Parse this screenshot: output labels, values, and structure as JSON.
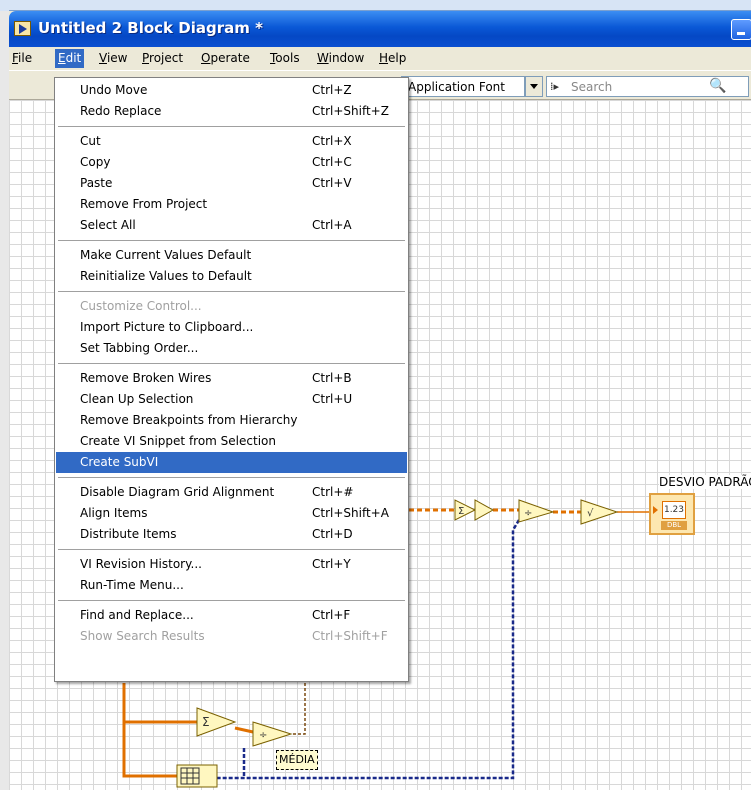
{
  "window": {
    "title": "Untitled 2 Block Diagram *"
  },
  "menubar": {
    "items": [
      {
        "label": "File",
        "u": "F",
        "rest": "ile"
      },
      {
        "label": "Edit",
        "u": "E",
        "rest": "dit"
      },
      {
        "label": "View",
        "u": "V",
        "rest": "iew"
      },
      {
        "label": "Project",
        "u": "P",
        "rest": "roject"
      },
      {
        "label": "Operate",
        "u": "O",
        "rest": "perate"
      },
      {
        "label": "Tools",
        "u": "T",
        "rest": "ools"
      },
      {
        "label": "Window",
        "u": "W",
        "rest": "indow"
      },
      {
        "label": "Help",
        "u": "H",
        "rest": "elp"
      }
    ]
  },
  "toolbar": {
    "font": "Application Font",
    "search_placeholder": "Search"
  },
  "edit_menu": {
    "groups": [
      [
        {
          "label": "Undo Move",
          "shortcut": "Ctrl+Z"
        },
        {
          "label": "Redo Replace",
          "shortcut": "Ctrl+Shift+Z"
        }
      ],
      [
        {
          "label": "Cut",
          "shortcut": "Ctrl+X"
        },
        {
          "label": "Copy",
          "shortcut": "Ctrl+C"
        },
        {
          "label": "Paste",
          "shortcut": "Ctrl+V"
        },
        {
          "label": "Remove From Project",
          "shortcut": ""
        },
        {
          "label": "Select All",
          "shortcut": "Ctrl+A"
        }
      ],
      [
        {
          "label": "Make Current Values Default",
          "shortcut": ""
        },
        {
          "label": "Reinitialize Values to Default",
          "shortcut": ""
        }
      ],
      [
        {
          "label": "Customize Control...",
          "shortcut": "",
          "disabled": true
        },
        {
          "label": "Import Picture to Clipboard...",
          "shortcut": ""
        },
        {
          "label": "Set Tabbing Order...",
          "shortcut": ""
        }
      ],
      [
        {
          "label": "Remove Broken Wires",
          "shortcut": "Ctrl+B"
        },
        {
          "label": "Clean Up Selection",
          "shortcut": "Ctrl+U"
        },
        {
          "label": "Remove Breakpoints from Hierarchy",
          "shortcut": ""
        },
        {
          "label": "Create VI Snippet from Selection",
          "shortcut": ""
        },
        {
          "label": "Create SubVI",
          "shortcut": "",
          "highlighted": true
        }
      ],
      [
        {
          "label": "Disable Diagram Grid Alignment",
          "shortcut": "Ctrl+#"
        },
        {
          "label": "Align Items",
          "shortcut": "Ctrl+Shift+A"
        },
        {
          "label": "Distribute Items",
          "shortcut": "Ctrl+D"
        }
      ],
      [
        {
          "label": "VI Revision History...",
          "shortcut": "Ctrl+Y"
        },
        {
          "label": "Run-Time Menu...",
          "shortcut": ""
        }
      ],
      [
        {
          "label": "Find and Replace...",
          "shortcut": "Ctrl+F"
        },
        {
          "label": "Show Search Results",
          "shortcut": "Ctrl+Shift+F",
          "disabled": true
        }
      ]
    ]
  },
  "diagram": {
    "indicator_label": "DESVIO PADRÃO",
    "indicator_value": "1.23",
    "indicator_type": "DBL",
    "media_label": "MÉDIA"
  },
  "colors": {
    "menu_highlight": "#316ac5",
    "wire_double": "#e07000",
    "wire_int": "#1a2a8a"
  }
}
